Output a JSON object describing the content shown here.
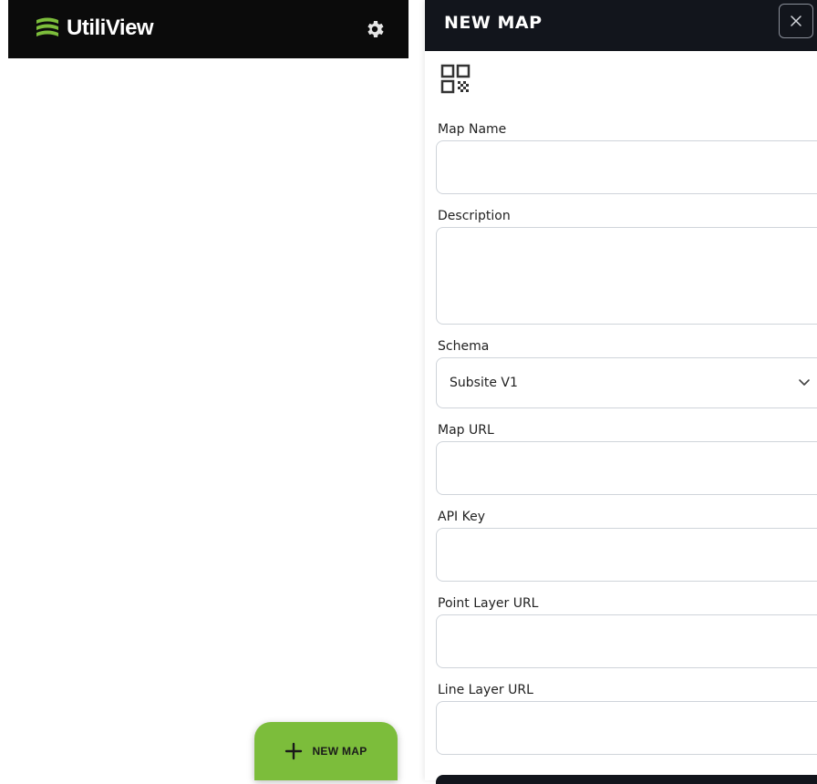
{
  "app": {
    "brand": "UtiliView",
    "settings_icon": "gear-icon",
    "new_map_button": "NEW MAP"
  },
  "panel": {
    "title": "NEW MAP",
    "close_icon": "close-icon",
    "qr_icon": "qr-code-icon",
    "fields": {
      "map_name": {
        "label": "Map Name",
        "value": ""
      },
      "description": {
        "label": "Description",
        "value": ""
      },
      "schema": {
        "label": "Schema",
        "value": "Subsite V1"
      },
      "map_url": {
        "label": "Map URL",
        "value": ""
      },
      "api_key": {
        "label": "API Key",
        "value": ""
      },
      "point_layer_url": {
        "label": "Point Layer URL",
        "value": ""
      },
      "line_layer_url": {
        "label": "Line Layer URL",
        "value": ""
      }
    }
  },
  "colors": {
    "header_bg": "#0b0b0b",
    "panel_header_bg": "#12151c",
    "accent_green": "#7cbd3b",
    "input_border": "#cfd4da"
  }
}
